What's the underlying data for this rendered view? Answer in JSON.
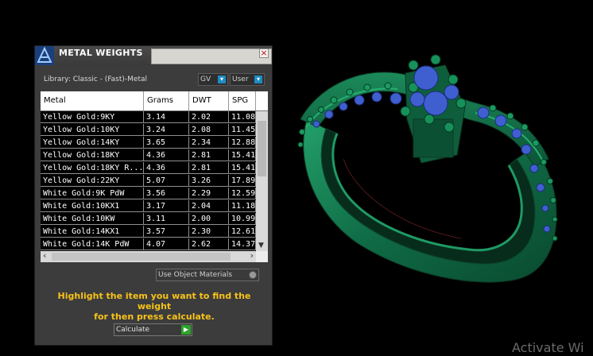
{
  "panel": {
    "title": "METAL WEIGHTS",
    "close_label": "×",
    "library_label": "Library: Classic - (Fast)-Metal",
    "dropdown_gv": "GV",
    "dropdown_user": "User"
  },
  "table": {
    "columns": [
      "Metal",
      "Grams",
      "DWT",
      "SPG"
    ],
    "rows": [
      [
        "Yellow Gold:9KY",
        "3.14",
        "2.02",
        "11.08"
      ],
      [
        "Yellow Gold:10KY",
        "3.24",
        "2.08",
        "11.45"
      ],
      [
        "Yellow Gold:14KY",
        "3.65",
        "2.34",
        "12.88"
      ],
      [
        "Yellow Gold:18KY",
        "4.36",
        "2.81",
        "15.41"
      ],
      [
        "Yellow Gold:18KY R...",
        "4.36",
        "2.81",
        "15.41"
      ],
      [
        "Yellow Gold:22KY",
        "5.07",
        "3.26",
        "17.89"
      ],
      [
        "White Gold:9K PdW",
        "3.56",
        "2.29",
        "12.59"
      ],
      [
        "White Gold:10KX1",
        "3.17",
        "2.04",
        "11.18"
      ],
      [
        "White Gold:10KW",
        "3.11",
        "2.00",
        "10.99"
      ],
      [
        "White Gold:14KX1",
        "3.57",
        "2.30",
        "12.61"
      ],
      [
        "White Gold:14K PdW",
        "4.07",
        "2.62",
        "14.37"
      ]
    ]
  },
  "materials": {
    "label": "Use Object Materials"
  },
  "hint": {
    "line1": "Highlight the item you want to find the weight",
    "line2": "for then press calculate."
  },
  "calculate": {
    "label": "Calculate"
  },
  "watermark": "Activate Wi",
  "colors": {
    "ring_green": "#0f6b45",
    "gem_blue": "#3f5fd0",
    "hint_yellow": "#f7c21a",
    "accent_blue": "#1e8bc3"
  }
}
